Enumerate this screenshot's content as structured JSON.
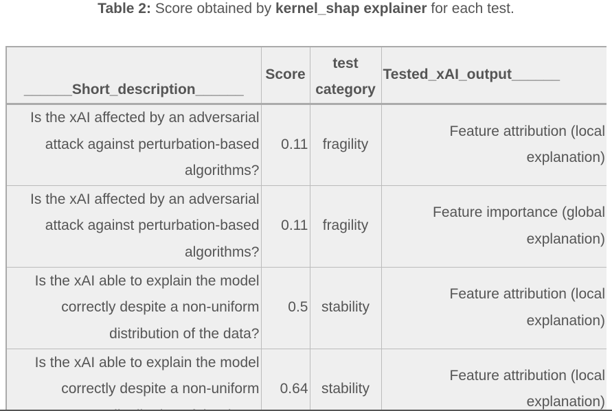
{
  "caption": {
    "label": "Table 2:",
    "text_before": "Score obtained by",
    "explainer": "kernel_shap explainer",
    "text_after": "for each test."
  },
  "table": {
    "headers": {
      "short_description": "______Short_description______",
      "score": "Score",
      "test_category": "test category",
      "tested_output": "Tested_xAI_output______"
    },
    "rows": [
      {
        "short_description": "Is the xAI affected by an adversarial attack against perturbation-based algorithms?",
        "score": "0.11",
        "test_category": "fragility",
        "tested_output": "Feature attribution (local explanation)"
      },
      {
        "short_description": "Is the xAI affected by an adversarial attack against perturbation-based algorithms?",
        "score": "0.11",
        "test_category": "fragility",
        "tested_output": "Feature importance (global explanation)"
      },
      {
        "short_description": "Is the xAI able to explain the model correctly despite a non-uniform distribution of the data?",
        "score": "0.5",
        "test_category": "stability",
        "tested_output": "Feature attribution (local explanation)"
      },
      {
        "short_description": "Is the xAI able to explain the model correctly despite a non-uniform distribution of the data?",
        "score": "0.64",
        "test_category": "stability",
        "tested_output": "Feature attribution (local explanation)"
      }
    ]
  }
}
